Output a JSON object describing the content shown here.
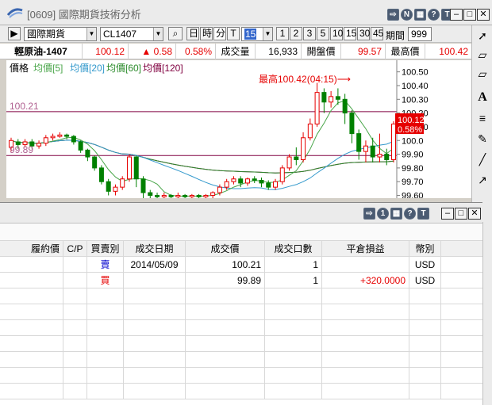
{
  "window": {
    "title": "[0609] 國際期貨技術分析"
  },
  "toolbar": {
    "exchange": "國際期貨",
    "symbol": "CL1407",
    "period_buttons": [
      "日",
      "時",
      "分",
      "T"
    ],
    "interval_value": "15",
    "interval_buttons": [
      "1",
      "2",
      "3",
      "5",
      "10",
      "15",
      "30",
      "45"
    ],
    "period_label": "期間",
    "period_value": "999"
  },
  "quote": {
    "name": "輕原油-1407",
    "price": "100.12",
    "change": "▲ 0.58",
    "change_pct": "0.58%",
    "volume_label": "成交量",
    "volume": "16,933",
    "open_label": "開盤價",
    "open": "99.57",
    "high_label": "最高價",
    "high": "100.42"
  },
  "chart_legend": {
    "price": "價格",
    "ma5": "均價[5]",
    "ma20": "均價[20]",
    "ma60": "均價[60]",
    "ma120": "均價[120]"
  },
  "chart_data": {
    "type": "line",
    "annotation_high": "最高100.42(04:15)⟶",
    "ref_line_top": "100.21",
    "ref_line_bottom": "99.89",
    "current_price_tag": "100.12",
    "current_pct_tag": "0.58%",
    "y_ticks": [
      "100.50",
      "100.40",
      "100.30",
      "100.20",
      "100.10",
      "100.0",
      "99.90",
      "99.80",
      "99.70",
      "99.60"
    ],
    "ylim": [
      99.58,
      100.55
    ],
    "colors": {
      "up": "#e60000",
      "down": "#008000",
      "ma5": "#4aa64a",
      "ma20": "#3399cc",
      "ma60": "#2a8a2a",
      "ma120": "#800040",
      "ref": "#800040"
    },
    "candles": [
      [
        99.95,
        100.0,
        99.92,
        100.02
      ],
      [
        99.99,
        99.97,
        99.94,
        100.01
      ],
      [
        99.97,
        99.99,
        99.95,
        100.01
      ],
      [
        99.99,
        99.96,
        99.94,
        100.01
      ],
      [
        99.96,
        99.98,
        99.94,
        100.0
      ],
      [
        99.98,
        100.02,
        99.96,
        100.04
      ],
      [
        100.02,
        100.03,
        100.0,
        100.05
      ],
      [
        100.03,
        100.04,
        100.02,
        100.06
      ],
      [
        100.04,
        100.03,
        100.01,
        100.05
      ],
      [
        100.03,
        99.99,
        99.97,
        100.04
      ],
      [
        99.99,
        99.93,
        99.91,
        100.0
      ],
      [
        99.93,
        99.88,
        99.85,
        99.94
      ],
      [
        99.88,
        99.8,
        99.78,
        99.89
      ],
      [
        99.8,
        99.7,
        99.68,
        99.82
      ],
      [
        99.7,
        99.63,
        99.6,
        99.72
      ],
      [
        99.63,
        99.66,
        99.6,
        99.68
      ],
      [
        99.66,
        99.72,
        99.64,
        99.74
      ],
      [
        99.72,
        99.88,
        99.7,
        99.9
      ],
      [
        99.88,
        99.72,
        99.66,
        99.89
      ],
      [
        99.72,
        99.62,
        99.58,
        99.74
      ],
      [
        99.62,
        99.6,
        99.58,
        99.64
      ],
      [
        99.6,
        99.59,
        99.58,
        99.62
      ],
      [
        99.59,
        99.6,
        99.58,
        99.62
      ],
      [
        99.6,
        99.59,
        99.58,
        99.61
      ],
      [
        99.59,
        99.6,
        99.58,
        99.62
      ],
      [
        99.6,
        99.59,
        99.58,
        99.61
      ],
      [
        99.59,
        99.6,
        99.58,
        99.61
      ],
      [
        99.6,
        99.59,
        99.58,
        99.61
      ],
      [
        99.59,
        99.6,
        99.58,
        99.61
      ],
      [
        99.6,
        99.62,
        99.58,
        99.63
      ],
      [
        99.62,
        99.66,
        99.6,
        99.68
      ],
      [
        99.66,
        99.7,
        99.64,
        99.72
      ],
      [
        99.7,
        99.72,
        99.68,
        99.74
      ],
      [
        99.72,
        99.69,
        99.66,
        99.74
      ],
      [
        99.69,
        99.72,
        99.67,
        99.73
      ],
      [
        99.72,
        99.71,
        99.69,
        99.74
      ],
      [
        99.71,
        99.69,
        99.66,
        99.73
      ],
      [
        99.69,
        99.66,
        99.64,
        99.71
      ],
      [
        99.66,
        99.7,
        99.64,
        99.72
      ],
      [
        99.7,
        99.8,
        99.68,
        99.82
      ],
      [
        99.8,
        99.88,
        99.78,
        99.9
      ],
      [
        99.88,
        99.86,
        99.82,
        99.95
      ],
      [
        99.86,
        100.02,
        99.84,
        100.06
      ],
      [
        100.02,
        100.12,
        100.0,
        100.16
      ],
      [
        100.12,
        100.35,
        100.1,
        100.42
      ],
      [
        100.35,
        100.28,
        100.2,
        100.38
      ],
      [
        100.28,
        100.32,
        100.24,
        100.36
      ],
      [
        100.32,
        100.3,
        100.26,
        100.38
      ],
      [
        100.3,
        100.2,
        100.12,
        100.34
      ],
      [
        100.2,
        100.05,
        99.98,
        100.22
      ],
      [
        100.05,
        99.92,
        99.86,
        100.08
      ],
      [
        99.92,
        99.96,
        99.84,
        100.0
      ],
      [
        99.96,
        99.88,
        99.84,
        100.02
      ],
      [
        99.88,
        99.9,
        99.84,
        100.05
      ],
      [
        99.9,
        99.86,
        99.82,
        99.94
      ],
      [
        99.86,
        100.12,
        99.84,
        100.14
      ]
    ]
  },
  "bottom_panel": {
    "columns": [
      "履約價",
      "C/P",
      "買賣別",
      "成交日期",
      "成交價",
      "成交口數",
      "平倉損益",
      "幣別"
    ],
    "rows": [
      {
        "strike": "",
        "cp": "",
        "side": "賣",
        "date": "2014/05/09",
        "price": "100.21",
        "qty": "1",
        "pnl": "",
        "currency": "USD"
      },
      {
        "strike": "",
        "cp": "",
        "side": "買",
        "date": "",
        "price": "99.89",
        "qty": "1",
        "pnl": "+320.0000",
        "currency": "USD"
      }
    ]
  }
}
